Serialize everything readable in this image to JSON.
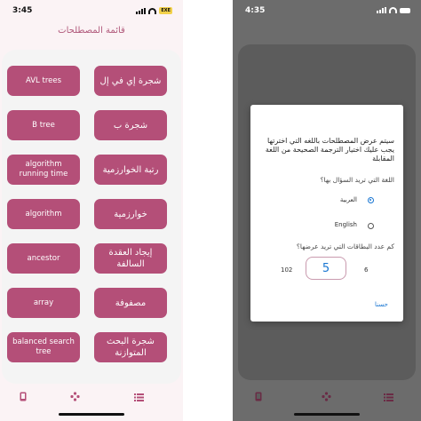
{
  "left_screen": {
    "status": {
      "time": "3:45",
      "battery": "EXE"
    },
    "header_title": "قائمة المصطلحات",
    "terms": [
      {
        "english": "AVL trees",
        "arabic": "شجرة إي في إل"
      },
      {
        "english": "B tree",
        "arabic": "شجرة ب"
      },
      {
        "english": "algorithm running time",
        "arabic": "رتبة الخوارزمية"
      },
      {
        "english": "algorithm",
        "arabic": "خوارزمية"
      },
      {
        "english": "ancestor",
        "arabic": "إيجاد العقدة السالفة"
      },
      {
        "english": "array",
        "arabic": "مصفوفة"
      },
      {
        "english": "balanced search tree",
        "arabic": "شجرة البحث المتوازنة"
      }
    ],
    "tabs": [
      "cards-icon",
      "game-icon",
      "list-icon"
    ]
  },
  "right_screen": {
    "status": {
      "time": "4:35"
    },
    "dialog": {
      "message": "سيتم عرض المصطلحات باللغه التي اخترتها يجب عليك اختيار الترجمة الصحيحة من اللغة المقابلة",
      "language_question": "اللغة التي تريد السؤال بها؟",
      "options": [
        "العربية",
        "English"
      ],
      "selected": "العربية",
      "cards_question": "كم عدد البطاقات التي تريد عرضها؟",
      "stepper_min": "6",
      "stepper_value": "5",
      "stepper_max": "102",
      "ok_label": "حسنا"
    }
  },
  "colors": {
    "accent": "#b44f78",
    "header_text": "#b0587a",
    "dialog_blue": "#1976d2",
    "overlay": "#6c6c6c"
  }
}
